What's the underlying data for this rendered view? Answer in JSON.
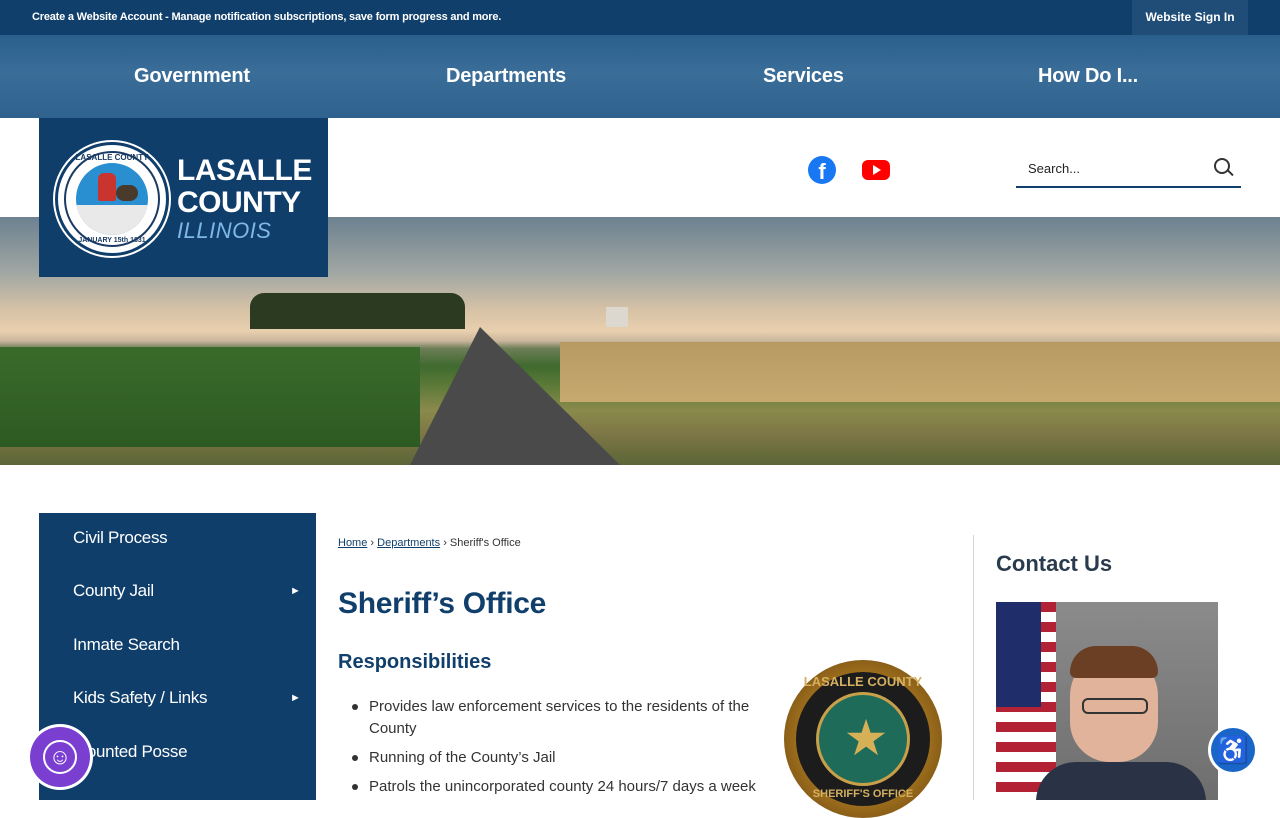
{
  "topbar": {
    "message": "Create a Website Account - Manage notification subscriptions, save form progress and more.",
    "signin_label": "Website Sign In"
  },
  "mainnav": {
    "items": [
      {
        "label": "Government"
      },
      {
        "label": "Departments"
      },
      {
        "label": "Services"
      },
      {
        "label": "How Do I..."
      }
    ]
  },
  "logo": {
    "seal_top": "LASALLE COUNTY",
    "seal_bottom": "JANUARY 15th 1831",
    "line1": "LASALLE",
    "line2": "COUNTY",
    "line3": "ILLINOIS"
  },
  "social": {
    "facebook_icon": "facebook-icon",
    "youtube_icon": "youtube-icon"
  },
  "search": {
    "placeholder": "Search...",
    "icon": "search-icon"
  },
  "sidenav": {
    "items": [
      {
        "label": "Civil Process",
        "has_submenu": false
      },
      {
        "label": "County Jail",
        "has_submenu": true
      },
      {
        "label": "Inmate Search",
        "has_submenu": false
      },
      {
        "label": "Kids Safety / Links",
        "has_submenu": true
      },
      {
        "label": "Mounted Posse",
        "has_submenu": false
      }
    ],
    "arrow": "►"
  },
  "breadcrumb": {
    "home": "Home",
    "separator": "›",
    "departments": "Departments",
    "current": "Sheriff's Office"
  },
  "main": {
    "title": "Sheriff’s Office",
    "subheading": "Responsibilities",
    "responsibilities": [
      "Provides law enforcement services to the residents of the County",
      "Running of the County’s Jail",
      "Patrols the unincorporated county 24 hours/7 days a week"
    ],
    "badge_top": "LASALLE COUNTY",
    "badge_bottom": "SHERIFF'S OFFICE"
  },
  "contact": {
    "title": "Contact Us"
  },
  "colors": {
    "primary_navy": "#103f6b",
    "accent_purple": "#7a3fd1",
    "accent_blue": "#1a66c8"
  }
}
